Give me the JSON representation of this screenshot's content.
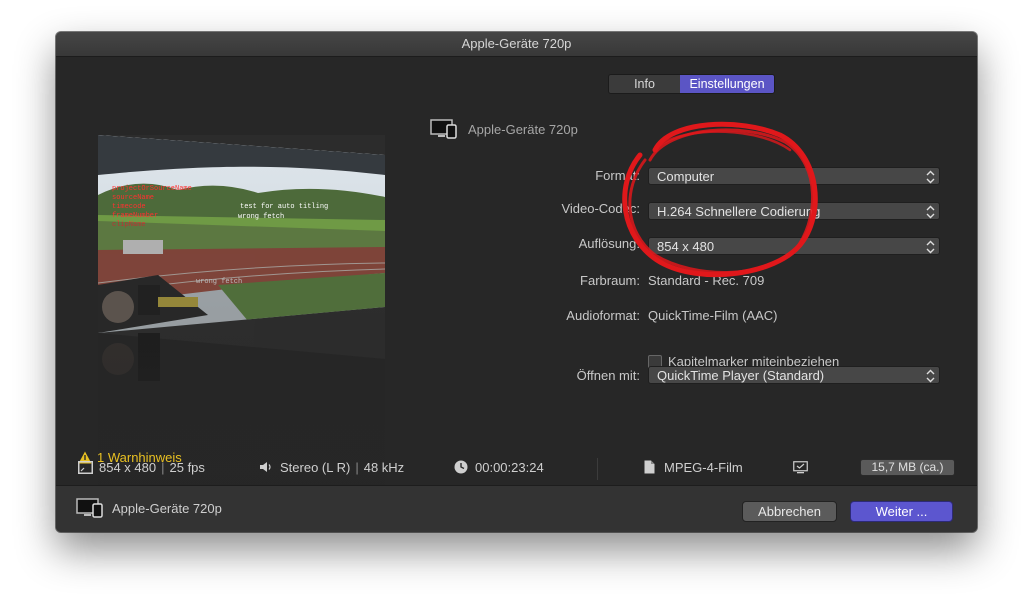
{
  "window": {
    "title": "Apple-Geräte 720p"
  },
  "tabs": [
    {
      "label": "Info",
      "selected": false
    },
    {
      "label": "Einstellungen",
      "selected": true
    }
  ],
  "device": {
    "name": "Apple-Geräte 720p",
    "icon": "computer-phone-icon"
  },
  "preview_overlay": {
    "line1": "test for auto titling",
    "line2": "wrong fetch",
    "line3": "wrong fetch"
  },
  "settings": {
    "format_label": "Format:",
    "format_value": "Computer",
    "codec_label": "Video-Codec:",
    "codec_value": "H.264 Schnellere Codierung",
    "resolution_label": "Auflösung:",
    "resolution_value": "854 x 480",
    "colorspace_label": "Farbraum:",
    "colorspace_value": "Standard - Rec. 709",
    "audio_label": "Audioformat:",
    "audio_value": "QuickTime-Film (AAC)",
    "chapters_label": "Kapitelmarker miteinbeziehen",
    "chapters_checked": false,
    "open_label": "Öffnen mit:",
    "open_value": "QuickTime Player (Standard)"
  },
  "warning": {
    "text": "1 Warnhinweis",
    "color": "#e8c022"
  },
  "info_strip": {
    "resolution": "854 x 480",
    "fps": "25 fps",
    "audio": "Stereo (L R)",
    "samplerate": "48 kHz",
    "duration": "00:00:23:24",
    "container": "MPEG-4-Film",
    "size": "15,7 MB (ca.)"
  },
  "footer": {
    "device_name": "Apple-Geräte 720p",
    "cancel_label": "Abbrechen",
    "next_label": "Weiter ..."
  },
  "colors": {
    "accent": "#5b55c5",
    "annotation": "#e0181b"
  }
}
